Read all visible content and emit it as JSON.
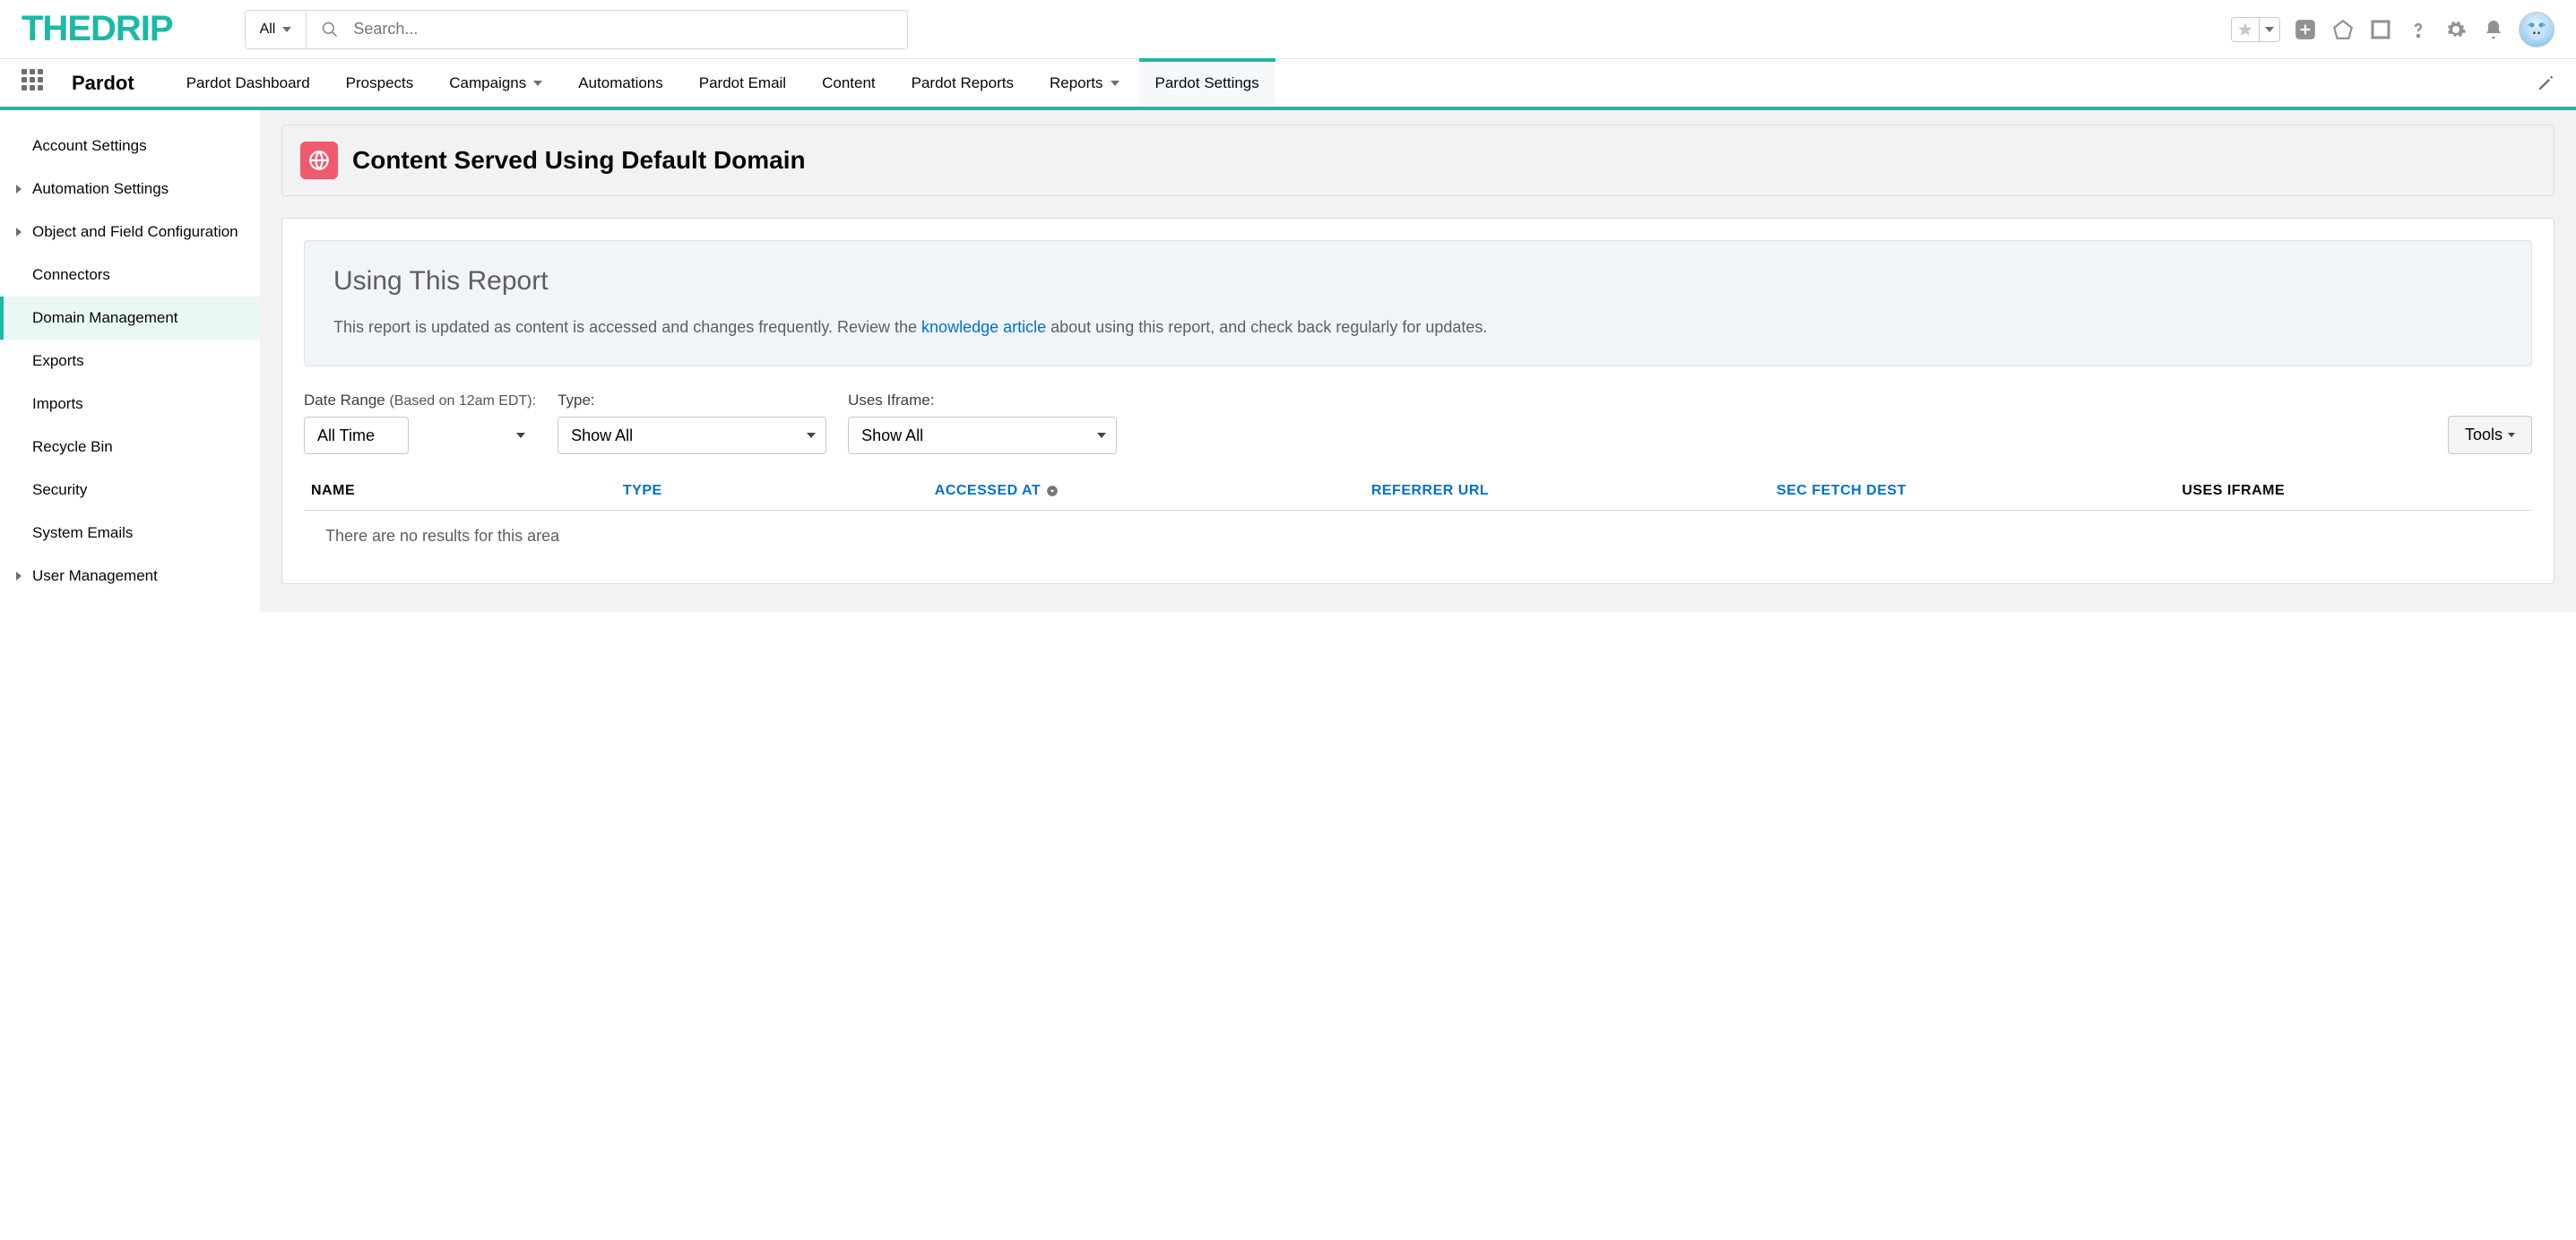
{
  "logo_text": "THEDRIP",
  "search": {
    "scope": "All",
    "placeholder": "Search..."
  },
  "app_name": "Pardot",
  "nav_tabs": [
    {
      "label": "Pardot Dashboard",
      "chevron": false
    },
    {
      "label": "Prospects",
      "chevron": false
    },
    {
      "label": "Campaigns",
      "chevron": true
    },
    {
      "label": "Automations",
      "chevron": false
    },
    {
      "label": "Pardot Email",
      "chevron": false
    },
    {
      "label": "Content",
      "chevron": false
    },
    {
      "label": "Pardot Reports",
      "chevron": false
    },
    {
      "label": "Reports",
      "chevron": true
    },
    {
      "label": "Pardot Settings",
      "chevron": false
    }
  ],
  "active_tab_index": 8,
  "sidebar": [
    {
      "label": "Account Settings",
      "children": false
    },
    {
      "label": "Automation Settings",
      "children": true
    },
    {
      "label": "Object and Field Configuration",
      "children": true
    },
    {
      "label": "Connectors",
      "children": false
    },
    {
      "label": "Domain Management",
      "children": false
    },
    {
      "label": "Exports",
      "children": false
    },
    {
      "label": "Imports",
      "children": false
    },
    {
      "label": "Recycle Bin",
      "children": false
    },
    {
      "label": "Security",
      "children": false
    },
    {
      "label": "System Emails",
      "children": false
    },
    {
      "label": "User Management",
      "children": true
    }
  ],
  "active_side_index": 4,
  "page_title": "Content Served Using Default Domain",
  "info": {
    "title": "Using This Report",
    "text_before": "This report is updated as content is accessed and changes frequently. Review the ",
    "link_text": "knowledge article",
    "text_after": " about using this report, and check back regularly for updates."
  },
  "filters": {
    "date_range": {
      "label": "Date Range ",
      "hint": "(Based on 12am EDT):",
      "value": "All Time"
    },
    "type": {
      "label": "Type:",
      "value": "Show All"
    },
    "uses_iframe": {
      "label": "Uses Iframe:",
      "value": "Show All"
    },
    "tools_label": "Tools"
  },
  "table": {
    "columns": [
      "NAME",
      "TYPE",
      "ACCESSED AT",
      "REFERRER URL",
      "SEC FETCH DEST",
      "USES IFRAME"
    ],
    "sorted_col_index": 2,
    "link_cols": [
      1,
      2,
      3,
      4
    ],
    "empty_text": "There are no results for this area"
  }
}
